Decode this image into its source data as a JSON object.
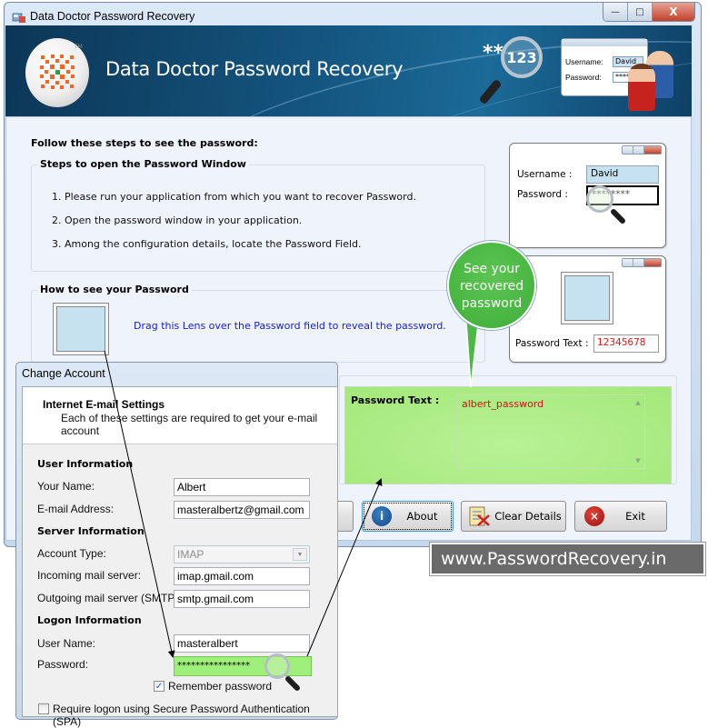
{
  "window": {
    "title": "Data Doctor Password Recovery",
    "controls": {
      "minimize": "—",
      "maximize": "□",
      "close": "X"
    }
  },
  "banner": {
    "title": "Data Doctor Password Recovery",
    "logo_tm": "TM",
    "art": {
      "stars": "**",
      "lens_text": "123",
      "username_label": "Username:",
      "username_value": "David",
      "password_label": "Password:",
      "password_value": "*****"
    }
  },
  "main": {
    "heading": "Follow these steps to see the password:",
    "steps_group": {
      "title": "Steps to open the Password Window",
      "steps": [
        "1.  Please run your application from which you want to recover Password.",
        "2.  Open the password window in your application.",
        "3.  Among the configuration details, locate the Password Field."
      ]
    },
    "howto_group": {
      "title": "How to see your Password",
      "instruction": "Drag this Lens over the Password field to reveal the password."
    },
    "demo_login": {
      "username_label": "Username :",
      "username_value": "David",
      "password_label": "Password  :",
      "password_value": "********"
    },
    "demo_result": {
      "label": "Password Text :",
      "value": "12345678"
    },
    "bubble": {
      "line1": "See your",
      "line2": "recovered",
      "line3": "password"
    },
    "result": {
      "label": "Password Text :",
      "value": "albert_password"
    },
    "buttons": {
      "about": "About",
      "clear": "Clear Details",
      "exit": "Exit"
    }
  },
  "watermark": "www.PasswordRecovery.in",
  "dialog": {
    "title": "Change Account",
    "header_title": "Internet E-mail Settings",
    "header_sub": "Each of these settings are required to get your e-mail account",
    "sections": {
      "user": "User Information",
      "server": "Server Information",
      "logon": "Logon Information"
    },
    "fields": {
      "your_name_label": "Your Name:",
      "your_name": "Albert",
      "email_label": "E-mail Address:",
      "email": "masteralbertz@gmail.com",
      "account_type_label": "Account Type:",
      "account_type": "IMAP",
      "incoming_label": "Incoming mail server:",
      "incoming": "imap.gmail.com",
      "outgoing_label": "Outgoing mail server (SMTP):",
      "outgoing": "smtp.gmail.com",
      "username_label": "User Name:",
      "username": "masteralbert",
      "password_label": "Password:",
      "password": "****************"
    },
    "remember_password": {
      "label": "Remember password",
      "checked": true
    },
    "spa": {
      "label": "Require logon using Secure Password Authentication (SPA)",
      "checked": false
    }
  },
  "colors": {
    "accent_green": "#a3e879",
    "bubble_green": "#4cb944",
    "revealed_text": "#c11616",
    "instruction_blue": "#1a22c8",
    "banner_blue": "#14557f"
  }
}
